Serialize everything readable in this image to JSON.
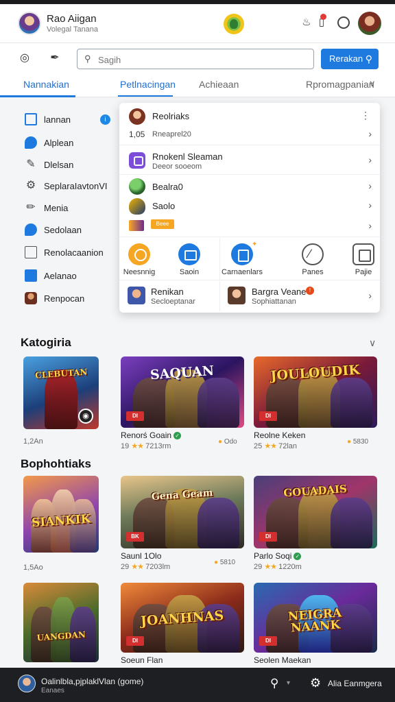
{
  "header": {
    "title": "Rao Aiigan",
    "subtitle": "Volegal Tanana"
  },
  "search": {
    "placeholder": "Sagih",
    "button_label": "Rerakan"
  },
  "tabs": [
    {
      "label": "Nannakian"
    },
    {
      "label": "Petlnacingan"
    },
    {
      "label": "Achieaan"
    },
    {
      "label": "Rpromagpanian"
    }
  ],
  "sidebar": {
    "items": [
      {
        "label": "lannan",
        "badge": "i"
      },
      {
        "label": "Alplean"
      },
      {
        "label": "Dlelsan"
      },
      {
        "label": "SeplaraIavtonVI"
      },
      {
        "label": "Menia"
      },
      {
        "label": "Sedolaan"
      },
      {
        "label": "Renolacaanion"
      },
      {
        "label": "Aelanao"
      },
      {
        "label": "Renpocan"
      }
    ]
  },
  "panel": {
    "row1": {
      "title": "Reolriaks",
      "num": "1,05",
      "sub": "Rneaprel20"
    },
    "row2": {
      "title": "Rnokenl Sleaman",
      "sub": "Deeor sooeom"
    },
    "row3": {
      "title": "Bealra0"
    },
    "row4": {
      "title": "Saolo"
    },
    "row5": {
      "tag": "Beee"
    },
    "grid": [
      {
        "label": "Neesnnig"
      },
      {
        "label": "Saoin"
      },
      {
        "label": "Carnaenlars"
      },
      {
        "label": "Panes"
      },
      {
        "label": "Pajie"
      }
    ],
    "footer": [
      {
        "title": "Renikan",
        "sub": "Secloeptanar"
      },
      {
        "title": "Bargra Veane",
        "sub": "Sophiattanan",
        "badge": "!"
      }
    ]
  },
  "sections": [
    {
      "title": "Katogiria"
    },
    {
      "title": "Bophohtiaks"
    }
  ],
  "cards": [
    {
      "banner": "CLEBUTAN",
      "name": "",
      "meta": "1,2An",
      "right": "",
      "tag": ""
    },
    {
      "banner": "SAQUAN",
      "name": "Renorś Goain",
      "verified": true,
      "meta": "19",
      "meta2": "7213rm",
      "right": "Odo",
      "tag": "DI"
    },
    {
      "banner": "JOULOUDIK",
      "name": "Reolne Keken",
      "meta": "25",
      "meta2": "72lan",
      "right": "5830",
      "tag": "DI"
    },
    {
      "banner": "SIANKIK",
      "name": "",
      "meta": "1,5Ao",
      "right": "",
      "tag": ""
    },
    {
      "banner": "Gena Geam",
      "name": "Saunl 1Olo",
      "meta": "29",
      "meta2": "7203lm",
      "right": "5810",
      "tag": "BK"
    },
    {
      "banner": "GOUADAIS",
      "name": "Parlo Soqi",
      "verified": true,
      "meta": "29",
      "meta2": "1220m",
      "right": "",
      "tag": "DI"
    },
    {
      "banner": "UANGDAN",
      "name": "",
      "meta": "",
      "right": "",
      "tag": ""
    },
    {
      "banner": "JOANHNAS",
      "name": "Soeun Flan",
      "meta": "",
      "right": "",
      "tag": "DI"
    },
    {
      "banner": "NEIGRA NAANK",
      "name": "Seolen Maekan",
      "meta": "",
      "right": "",
      "tag": "DI"
    }
  ],
  "bottombar": {
    "title": "Oalinlbla,pjplaklVlan (gome)",
    "sub": "Eanaes",
    "label": "Alia Eanmgera"
  },
  "colors": {
    "accent": "#1f7ae0",
    "bottombar": "#1e1f22",
    "star": "#f5a623"
  }
}
